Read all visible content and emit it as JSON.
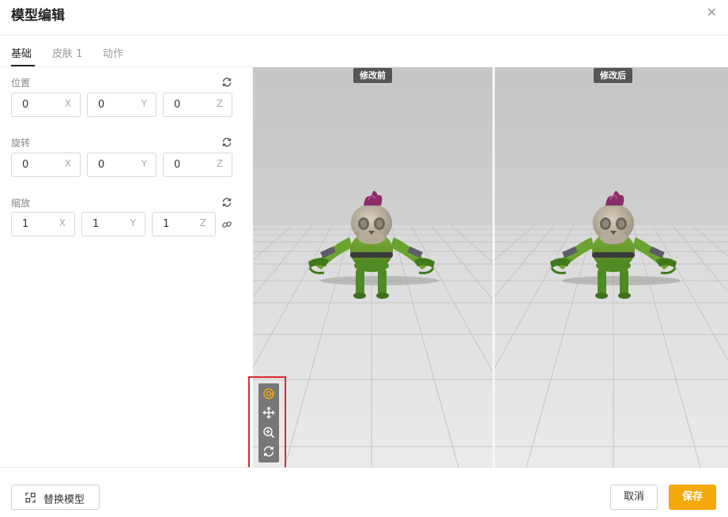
{
  "dialog": {
    "title": "模型编辑"
  },
  "tabs": [
    {
      "label": "基础",
      "active": true
    },
    {
      "label": "皮肤 1",
      "active": false
    },
    {
      "label": "动作",
      "active": false
    }
  ],
  "transform": {
    "position": {
      "label": "位置",
      "x": "0",
      "y": "0",
      "z": "0"
    },
    "rotation": {
      "label": "旋转",
      "x": "0",
      "y": "0",
      "z": "0"
    },
    "scale": {
      "label": "缩放",
      "x": "1",
      "y": "1",
      "z": "1"
    },
    "axis_labels": {
      "x": "X",
      "y": "Y",
      "z": "Z"
    }
  },
  "viewport": {
    "before_label": "修改前",
    "after_label": "修改后",
    "toolbar": [
      "focus-icon",
      "move-icon",
      "zoom-in-icon",
      "rotate-icon"
    ],
    "active_tool": "focus-icon"
  },
  "footer": {
    "replace_label": "替换模型",
    "cancel_label": "取消",
    "save_label": "保存"
  },
  "colors": {
    "accent": "#f5a80a",
    "highlight_box": "#e0262d",
    "toolbar_bg": "#777777"
  }
}
